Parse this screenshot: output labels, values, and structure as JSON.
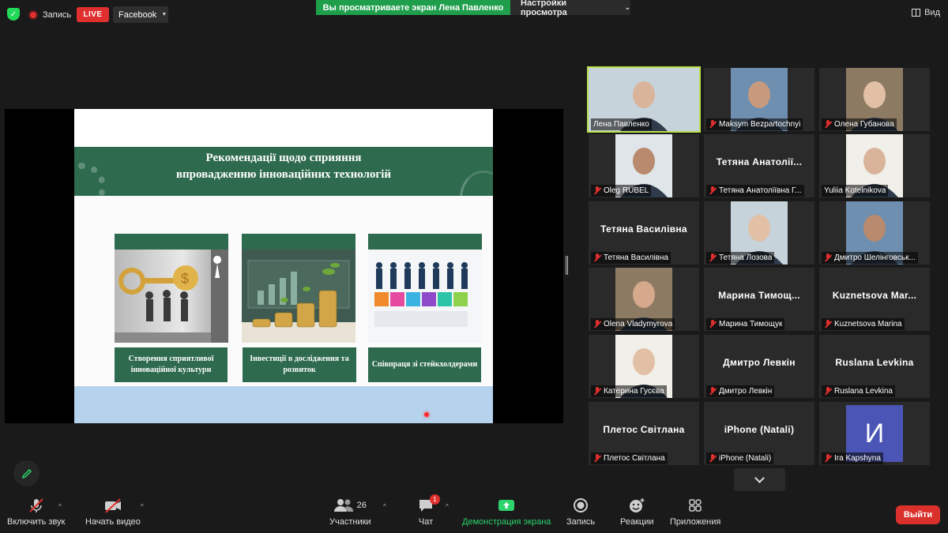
{
  "topbar": {
    "record_label": "Запись",
    "live_label": "LIVE",
    "stream_target": "Facebook",
    "viewing_text": "Вы просматриваете экран Лена Павленко",
    "view_options_label": "Настройки просмотра",
    "view_label": "Вид"
  },
  "slide": {
    "title_line1": "Рекомендації щодо сприяння",
    "title_line2": "впровадженню інноваційних технологій",
    "cards": [
      {
        "label": "Створення сприятливої інноваційної культури"
      },
      {
        "label": "Інвестиції в дослідження та розвиток"
      },
      {
        "label": "Співпраця зі стейкхолдерами"
      }
    ],
    "colors": {
      "header": "#2e6a4e",
      "footer": "#b6d3ee"
    }
  },
  "participants": [
    {
      "name": "Лена Павленко",
      "muted": false,
      "video": true,
      "active": true
    },
    {
      "name": "Maksym Bezpartochnyi",
      "muted": true,
      "video": true
    },
    {
      "name": "Олена Губанова",
      "muted": true,
      "video": true
    },
    {
      "name": "Oleg RUBEL",
      "muted": true,
      "video": true
    },
    {
      "name": "Тетяна Анатоліївна Г...",
      "display": "Тетяна  Анатолії...",
      "muted": true,
      "video": false
    },
    {
      "name": "Yuliia Kotelnikova",
      "muted": false,
      "video": true
    },
    {
      "name": "Тетяна Василівна",
      "display": "Тетяна Василівна",
      "muted": true,
      "video": false
    },
    {
      "name": "Тетяна Лозова",
      "muted": true,
      "video": true
    },
    {
      "name": "Дмитро Шелінговськ...",
      "muted": true,
      "video": true
    },
    {
      "name": "Olena Vladymyrova",
      "muted": true,
      "video": true
    },
    {
      "name": "Марина Тимощук",
      "display": "Марина  Тимощ...",
      "muted": true,
      "video": false
    },
    {
      "name": "Kuznetsova Marina",
      "display": "Kuznetsova  Mar...",
      "muted": true,
      "video": false
    },
    {
      "name": "Катерина Гусєва",
      "muted": true,
      "video": true
    },
    {
      "name": "Дмитро Левкін",
      "display": "Дмитро Левкін",
      "muted": true,
      "video": false
    },
    {
      "name": "Ruslana Levkina",
      "display": "Ruslana Levkina",
      "muted": true,
      "video": false
    },
    {
      "name": "Плетос Світлана",
      "display": "Плетос Світлана",
      "muted": true,
      "video": false
    },
    {
      "name": "iPhone (Natali)",
      "display": "iPhone (Natali)",
      "muted": true,
      "video": false
    },
    {
      "name": "Ira Kapshyna",
      "avatar_letter": "И",
      "muted": true,
      "video": false
    }
  ],
  "toolbar": {
    "unmute": "Включить звук",
    "start_video": "Начать видео",
    "participants": "Участники",
    "participants_count": "26",
    "chat": "Чат",
    "chat_badge": "1",
    "share_screen": "Демонстрация экрана",
    "record": "Запись",
    "reactions": "Реакции",
    "apps": "Приложения",
    "leave": "Выйти"
  }
}
